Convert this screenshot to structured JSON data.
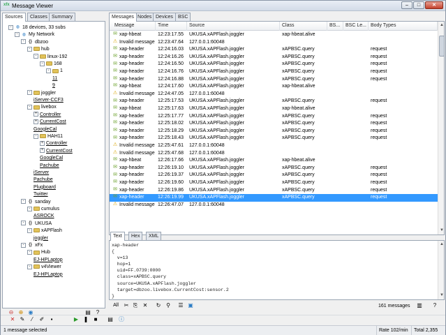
{
  "window": {
    "title": "Message Viewer",
    "app_icon": "xfx"
  },
  "left_tabs": [
    "Sources",
    "Classes",
    "Summary"
  ],
  "tree": [
    {
      "d": 0,
      "ex": "-",
      "icon": "net",
      "label": "18 devices, 33 subs",
      "u": false
    },
    {
      "d": 1,
      "ex": "-",
      "icon": "net",
      "label": "My Network",
      "u": false
    },
    {
      "d": 2,
      "ex": "-",
      "icon": "node",
      "label": "dbzoo",
      "u": false
    },
    {
      "d": 3,
      "ex": "-",
      "icon": "folder",
      "label": "hub",
      "u": false
    },
    {
      "d": 4,
      "ex": "-",
      "icon": "folder",
      "label": "linux-192",
      "u": false
    },
    {
      "d": 5,
      "ex": "-",
      "icon": "folder",
      "label": "168",
      "u": false
    },
    {
      "d": 6,
      "ex": "-",
      "icon": "folder",
      "label": "1",
      "u": false
    },
    {
      "d": 7,
      "ex": "",
      "icon": "",
      "label": "11",
      "u": true
    },
    {
      "d": 7,
      "ex": "",
      "icon": "",
      "label": "9",
      "u": true
    },
    {
      "d": 3,
      "ex": "-",
      "icon": "folder",
      "label": "joggler",
      "u": false
    },
    {
      "d": 4,
      "ex": "",
      "icon": "",
      "label": "iServer-CCF3",
      "u": true
    },
    {
      "d": 3,
      "ex": "-",
      "icon": "folder",
      "label": "livebox",
      "u": false
    },
    {
      "d": 4,
      "ex": "+",
      "icon": "",
      "label": "Controller",
      "u": true
    },
    {
      "d": 4,
      "ex": "+",
      "icon": "",
      "label": "CurrentCost",
      "u": true
    },
    {
      "d": 4,
      "ex": "",
      "icon": "",
      "label": "GoogleCal",
      "u": true
    },
    {
      "d": 4,
      "ex": "-",
      "icon": "folder",
      "label": "HAH11",
      "u": false
    },
    {
      "d": 5,
      "ex": "+",
      "icon": "",
      "label": "Controller",
      "u": true
    },
    {
      "d": 5,
      "ex": "+",
      "icon": "",
      "label": "CurrentCost",
      "u": true
    },
    {
      "d": 5,
      "ex": "",
      "icon": "",
      "label": "GoogleCal",
      "u": true
    },
    {
      "d": 5,
      "ex": "",
      "icon": "",
      "label": "Pachube",
      "u": true
    },
    {
      "d": 4,
      "ex": "",
      "icon": "",
      "label": "iServer",
      "u": true
    },
    {
      "d": 4,
      "ex": "",
      "icon": "",
      "label": "Pachube",
      "u": true
    },
    {
      "d": 4,
      "ex": "",
      "icon": "",
      "label": "Plugboard",
      "u": true
    },
    {
      "d": 4,
      "ex": "",
      "icon": "",
      "label": "Twitter",
      "u": true
    },
    {
      "d": 2,
      "ex": "-",
      "icon": "node",
      "label": "sanday",
      "u": false
    },
    {
      "d": 3,
      "ex": "-",
      "icon": "folder",
      "label": "cumulus",
      "u": false
    },
    {
      "d": 4,
      "ex": "",
      "icon": "",
      "label": "ASROCK",
      "u": true
    },
    {
      "d": 2,
      "ex": "-",
      "icon": "node",
      "label": "UKUSA",
      "u": false
    },
    {
      "d": 3,
      "ex": "-",
      "icon": "folder",
      "label": "xAPFlash",
      "u": false
    },
    {
      "d": 4,
      "ex": "",
      "icon": "",
      "label": "joggler",
      "u": true
    },
    {
      "d": 2,
      "ex": "-",
      "icon": "node",
      "label": "xFx",
      "u": false
    },
    {
      "d": 3,
      "ex": "-",
      "icon": "folder",
      "label": "Hub",
      "u": false
    },
    {
      "d": 4,
      "ex": "",
      "icon": "",
      "label": "EJ-HPLaptop",
      "u": true
    },
    {
      "d": 3,
      "ex": "-",
      "icon": "folder",
      "label": "v4Viewer",
      "u": false
    },
    {
      "d": 4,
      "ex": "",
      "icon": "",
      "label": "EJ-HPLaptop",
      "u": true
    }
  ],
  "right_tabs": [
    "Messages",
    "Nodes",
    "Devices",
    "BSC"
  ],
  "columns": [
    "Message",
    "Time",
    "Source",
    "Class",
    "BS...",
    "BSC Le...",
    "Body Types"
  ],
  "rows": [
    {
      "i": "msg",
      "m": "xap-hbeat",
      "t": "12:23:17.55",
      "s": "UKUSA.xAPFlash.joggler",
      "c": "xap-hbeat.alive",
      "b": ""
    },
    {
      "i": "warn",
      "m": "Invalid message",
      "t": "12:23:47.64",
      "s": "127.0.0.1:60048",
      "c": "",
      "b": ""
    },
    {
      "i": "msg",
      "m": "xap-header",
      "t": "12:24:16.03",
      "s": "UKUSA.xAPFlash.joggler",
      "c": "xAPBSC.query",
      "b": "request"
    },
    {
      "i": "msg",
      "m": "xap-header",
      "t": "12:24:16.26",
      "s": "UKUSA.xAPFlash.joggler",
      "c": "xAPBSC.query",
      "b": "request"
    },
    {
      "i": "msg",
      "m": "xap-header",
      "t": "12:24:16.50",
      "s": "UKUSA.xAPFlash.joggler",
      "c": "xAPBSC.query",
      "b": "request"
    },
    {
      "i": "msg",
      "m": "xap-header",
      "t": "12:24:16.76",
      "s": "UKUSA.xAPFlash.joggler",
      "c": "xAPBSC.query",
      "b": "request"
    },
    {
      "i": "msg",
      "m": "xap-header",
      "t": "12:24:16.88",
      "s": "UKUSA.xAPFlash.joggler",
      "c": "xAPBSC.query",
      "b": "request"
    },
    {
      "i": "msg",
      "m": "xap-hbeat",
      "t": "12:24:17.60",
      "s": "UKUSA.xAPFlash.joggler",
      "c": "xap-hbeat.alive",
      "b": ""
    },
    {
      "i": "warn",
      "m": "Invalid message",
      "t": "12:24:47.05",
      "s": "127.0.0.1:60048",
      "c": "",
      "b": ""
    },
    {
      "i": "msg",
      "m": "xap-header",
      "t": "12:25:17.53",
      "s": "UKUSA.xAPFlash.joggler",
      "c": "xAPBSC.query",
      "b": "request"
    },
    {
      "i": "msg",
      "m": "xap-hbeat",
      "t": "12:25:17.63",
      "s": "UKUSA.xAPFlash.joggler",
      "c": "xap-hbeat.alive",
      "b": ""
    },
    {
      "i": "msg",
      "m": "xap-header",
      "t": "12:25:17.77",
      "s": "UKUSA.xAPFlash.joggler",
      "c": "xAPBSC.query",
      "b": "request"
    },
    {
      "i": "msg",
      "m": "xap-header",
      "t": "12:25:18.02",
      "s": "UKUSA.xAPFlash.joggler",
      "c": "xAPBSC.query",
      "b": "request"
    },
    {
      "i": "msg",
      "m": "xap-header",
      "t": "12:25:18.29",
      "s": "UKUSA.xAPFlash.joggler",
      "c": "xAPBSC.query",
      "b": "request"
    },
    {
      "i": "msg",
      "m": "xap-header",
      "t": "12:25:18.43",
      "s": "UKUSA.xAPFlash.joggler",
      "c": "xAPBSC.query",
      "b": "request"
    },
    {
      "i": "warn",
      "m": "Invalid message",
      "t": "12:25:47.61",
      "s": "127.0.0.1:60048",
      "c": "",
      "b": ""
    },
    {
      "i": "warn",
      "m": "Invalid message",
      "t": "12:25:47.68",
      "s": "127.0.0.1:60048",
      "c": "",
      "b": ""
    },
    {
      "i": "msg",
      "m": "xap-hbeat",
      "t": "12:26:17.66",
      "s": "UKUSA.xAPFlash.joggler",
      "c": "xap-hbeat.alive",
      "b": ""
    },
    {
      "i": "msg",
      "m": "xap-header",
      "t": "12:26:19.10",
      "s": "UKUSA.xAPFlash.joggler",
      "c": "xAPBSC.query",
      "b": "request"
    },
    {
      "i": "msg",
      "m": "xap-header",
      "t": "12:26:19.37",
      "s": "UKUSA.xAPFlash.joggler",
      "c": "xAPBSC.query",
      "b": "request"
    },
    {
      "i": "msg",
      "m": "xap-header",
      "t": "12:26:19.60",
      "s": "UKUSA.xAPFlash.joggler",
      "c": "xAPBSC.query",
      "b": "request"
    },
    {
      "i": "msg",
      "m": "xap-header",
      "t": "12:26:19.86",
      "s": "UKUSA.xAPFlash.joggler",
      "c": "xAPBSC.query",
      "b": "request"
    },
    {
      "i": "msg",
      "m": "xap-header",
      "t": "12:26:19.99",
      "s": "UKUSA.xAPFlash.joggler",
      "c": "xAPBSC.query",
      "b": "request",
      "sel": true
    },
    {
      "i": "warn",
      "m": "Invalid message",
      "t": "12:26:47.07",
      "s": "127.0.0.1:60048",
      "c": "",
      "b": ""
    }
  ],
  "detail_tabs": [
    "Text",
    "Hex",
    "XML"
  ],
  "detail_text": "xap-header\n{\n  v=13\n  hop=1\n  uid=FF.0739:0000\n  class=xAPBSC.query\n  source=UKUSA.xAPFlash.joggler\n  target=dbzoo.livebox.CurrentCost:sensor.2\n}",
  "detail_tools": {
    "all_label": "All",
    "count": "161 messages"
  },
  "status": {
    "left": "1 message selected",
    "rate": "Rate 102/min",
    "total": "Total 2,355"
  },
  "colors": {
    "selection": "#3399ff",
    "warning": "#d9a400",
    "message": "#6aa02a"
  }
}
